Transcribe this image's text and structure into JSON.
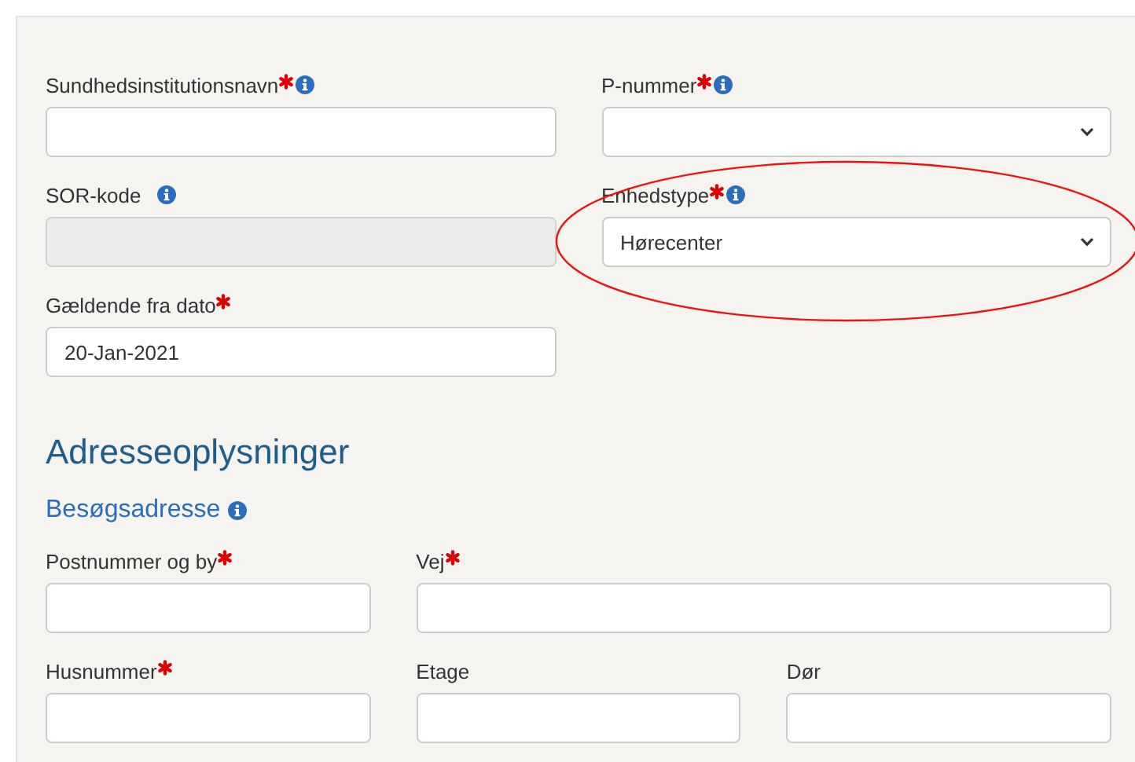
{
  "form": {
    "rows": [
      {
        "fields": [
          {
            "label": "Sundhedsinstitutionsnavn",
            "required": true,
            "info": true,
            "kind": "text"
          },
          {
            "label": "P-nummer",
            "required": true,
            "info": true,
            "kind": "select"
          }
        ]
      },
      {
        "fields": [
          {
            "label": "SOR-kode",
            "required": false,
            "info": true,
            "kind": "disabled"
          },
          {
            "label": "Enhedstype",
            "required": true,
            "info": true,
            "kind": "select",
            "value": "Hørecenter"
          }
        ]
      },
      {
        "fields": [
          {
            "label": "Gældende fra dato",
            "required": true,
            "info": false,
            "kind": "text",
            "value": "20-Jan-2021"
          }
        ]
      }
    ]
  },
  "address": {
    "title": "Adresseoplysninger",
    "subtitle": "Besøgsadresse",
    "subtitle_info": true,
    "rows": [
      {
        "fields": [
          {
            "label": "Postnummer og by",
            "required": true,
            "info": false,
            "kind": "text"
          },
          {
            "label": "Vej",
            "required": true,
            "info": false,
            "kind": "text"
          }
        ]
      },
      {
        "fields": [
          {
            "label": "Husnummer",
            "required": true,
            "info": false,
            "kind": "text"
          },
          {
            "label": "Etage",
            "required": false,
            "info": false,
            "kind": "text"
          },
          {
            "label": "Dør",
            "required": false,
            "info": false,
            "kind": "text"
          }
        ]
      }
    ]
  }
}
